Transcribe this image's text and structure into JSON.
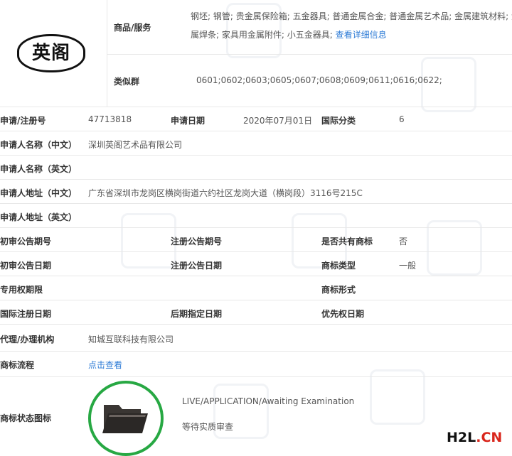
{
  "goods": {
    "label": "商品/服务",
    "line1": "钢坯; 钢管; 贵金属保险箱; 五金器具; 普通金属合金; 普通金属艺术品; 金属建筑材料; 金",
    "line2": "属焊条; 家具用金属附件; 小五金器具;",
    "detail_link": "查看详细信息"
  },
  "logo_text": "英阁",
  "similar_group": {
    "label": "类似群",
    "value": "0601;0602;0603;0605;0607;0608;0609;0611;0616;0622;"
  },
  "fields": {
    "reg_no_label": "申请/注册号",
    "reg_no": "47713818",
    "apply_date_label": "申请日期",
    "apply_date": "2020年07月01日",
    "intl_class_label": "国际分类",
    "intl_class": "6",
    "applicant_cn_label": "申请人名称（中文）",
    "applicant_cn": "深圳英阁艺术品有限公司",
    "applicant_en_label": "申请人名称（英文）",
    "applicant_en": "",
    "address_cn_label": "申请人地址（中文）",
    "address_cn": "广东省深圳市龙岗区横岗街道六约社区龙岗大道（横岗段）3116号215C",
    "address_en_label": "申请人地址（英文）",
    "address_en": "",
    "prelim_no_label": "初审公告期号",
    "prelim_no": "",
    "reg_pub_no_label": "注册公告期号",
    "reg_pub_no": "",
    "shared_label": "是否共有商标",
    "shared": "否",
    "prelim_date_label": "初审公告日期",
    "prelim_date": "",
    "reg_pub_date_label": "注册公告日期",
    "reg_pub_date": "",
    "tm_type_label": "商标类型",
    "tm_type": "一般",
    "exclusive_label": "专用权期限",
    "exclusive": "",
    "tm_form_label": "商标形式",
    "tm_form": "",
    "intl_reg_date_label": "国际注册日期",
    "intl_reg_date": "",
    "later_date_label": "后期指定日期",
    "later_date": "",
    "priority_date_label": "优先权日期",
    "priority_date": "",
    "agent_label": "代理/办理机构",
    "agent": "知城互联科技有限公司",
    "process_label": "商标流程",
    "process_link": "点击查看",
    "status_icon_label": "商标状态图标"
  },
  "status": {
    "en": "LIVE/APPLICATION/Awaiting Examination",
    "cn": "等待实质审查",
    "icon": "folder-icon",
    "ring_color": "#27a843"
  },
  "watermark_brand": {
    "h2l": "H2L",
    "cn": ".CN"
  }
}
